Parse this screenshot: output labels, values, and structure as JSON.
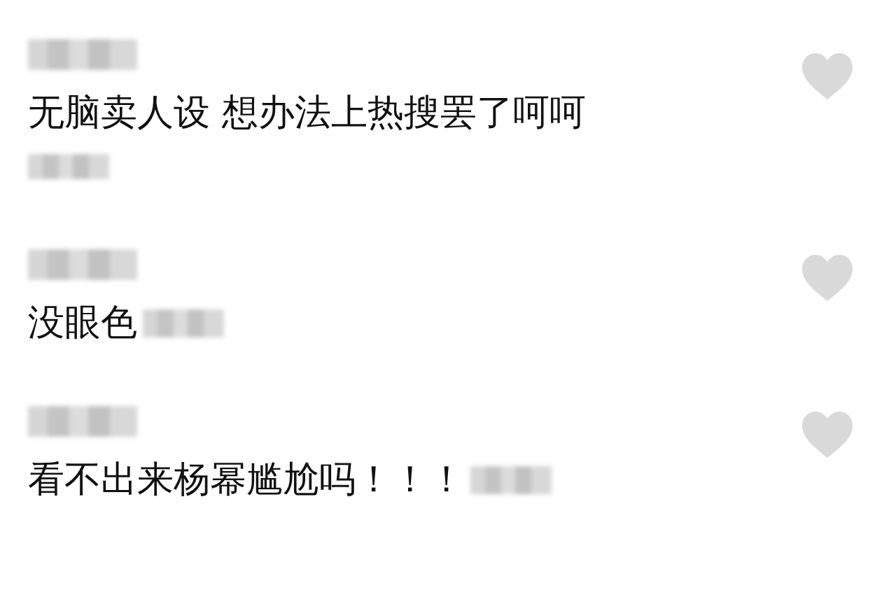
{
  "comments": [
    {
      "kind": "meta-below",
      "text": "无脑卖人设 想办法上热搜罢了呵呵",
      "liked": false
    },
    {
      "kind": "meta-inline",
      "text": "没眼色",
      "liked": false
    },
    {
      "kind": "meta-inline",
      "text": "看不出来杨幂尴尬吗！！！",
      "liked": false
    }
  ]
}
